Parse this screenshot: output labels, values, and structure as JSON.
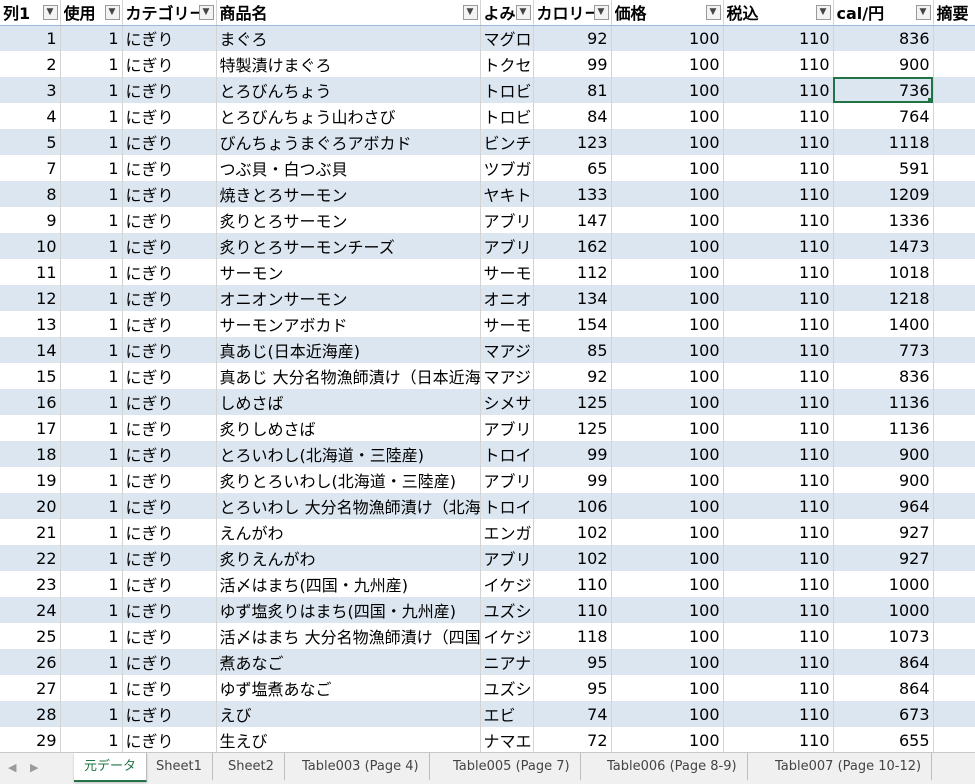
{
  "headers": [
    "列1",
    "使用",
    "カテゴリー",
    "商品名",
    "よみ",
    "カロリー",
    "価格",
    "税込",
    "cal/円",
    "摘要"
  ],
  "rows": [
    [
      "1",
      "1",
      "にぎり",
      "まぐろ",
      "マグロ",
      "92",
      "100",
      "110",
      "836",
      ""
    ],
    [
      "2",
      "1",
      "にぎり",
      "特製漬けまぐろ",
      "トクセ",
      "99",
      "100",
      "110",
      "900",
      ""
    ],
    [
      "3",
      "1",
      "にぎり",
      "とろびんちょう",
      "トロビ",
      "81",
      "100",
      "110",
      "736",
      ""
    ],
    [
      "4",
      "1",
      "にぎり",
      "とろびんちょう山わさび",
      "トロビ",
      "84",
      "100",
      "110",
      "764",
      ""
    ],
    [
      "5",
      "1",
      "にぎり",
      "びんちょうまぐろアボカド",
      "ビンチ",
      "123",
      "100",
      "110",
      "1118",
      ""
    ],
    [
      "7",
      "1",
      "にぎり",
      "つぶ貝・白つぶ貝",
      "ツブガ",
      "65",
      "100",
      "110",
      "591",
      ""
    ],
    [
      "8",
      "1",
      "にぎり",
      "焼きとろサーモン",
      "ヤキト",
      "133",
      "100",
      "110",
      "1209",
      ""
    ],
    [
      "9",
      "1",
      "にぎり",
      "炙りとろサーモン",
      "アブリ",
      "147",
      "100",
      "110",
      "1336",
      ""
    ],
    [
      "10",
      "1",
      "にぎり",
      "炙りとろサーモンチーズ",
      "アブリ",
      "162",
      "100",
      "110",
      "1473",
      ""
    ],
    [
      "11",
      "1",
      "にぎり",
      "サーモン",
      "サーモ",
      "112",
      "100",
      "110",
      "1018",
      ""
    ],
    [
      "12",
      "1",
      "にぎり",
      "オニオンサーモン",
      "オニオ",
      "134",
      "100",
      "110",
      "1218",
      ""
    ],
    [
      "13",
      "1",
      "にぎり",
      "サーモンアボカド",
      "サーモ",
      "154",
      "100",
      "110",
      "1400",
      ""
    ],
    [
      "14",
      "1",
      "にぎり",
      "真あじ(日本近海産)",
      "マアジ",
      "85",
      "100",
      "110",
      "773",
      ""
    ],
    [
      "15",
      "1",
      "にぎり",
      "真あじ 大分名物漁師漬け（日本近海",
      "マアジ",
      "92",
      "100",
      "110",
      "836",
      ""
    ],
    [
      "16",
      "1",
      "にぎり",
      "しめさば",
      "シメサ",
      "125",
      "100",
      "110",
      "1136",
      ""
    ],
    [
      "17",
      "1",
      "にぎり",
      "炙りしめさば",
      "アブリ",
      "125",
      "100",
      "110",
      "1136",
      ""
    ],
    [
      "18",
      "1",
      "にぎり",
      "とろいわし(北海道・三陸産)",
      "トロイ",
      "99",
      "100",
      "110",
      "900",
      ""
    ],
    [
      "19",
      "1",
      "にぎり",
      "炙りとろいわし(北海道・三陸産)",
      "アブリ",
      "99",
      "100",
      "110",
      "900",
      ""
    ],
    [
      "20",
      "1",
      "にぎり",
      "とろいわし 大分名物漁師漬け（北海",
      "トロイ",
      "106",
      "100",
      "110",
      "964",
      ""
    ],
    [
      "21",
      "1",
      "にぎり",
      "えんがわ",
      "エンガ",
      "102",
      "100",
      "110",
      "927",
      ""
    ],
    [
      "22",
      "1",
      "にぎり",
      "炙りえんがわ",
      "アブリ",
      "102",
      "100",
      "110",
      "927",
      ""
    ],
    [
      "23",
      "1",
      "にぎり",
      "活〆はまち(四国・九州産)",
      "イケジ",
      "110",
      "100",
      "110",
      "1000",
      ""
    ],
    [
      "24",
      "1",
      "にぎり",
      "ゆず塩炙りはまち(四国・九州産)",
      "ユズシ",
      "110",
      "100",
      "110",
      "1000",
      ""
    ],
    [
      "25",
      "1",
      "にぎり",
      "活〆はまち 大分名物漁師漬け（四国",
      "イケジ",
      "118",
      "100",
      "110",
      "1073",
      ""
    ],
    [
      "26",
      "1",
      "にぎり",
      "煮あなご",
      "ニアナ",
      "95",
      "100",
      "110",
      "864",
      ""
    ],
    [
      "27",
      "1",
      "にぎり",
      "ゆず塩煮あなご",
      "ユズシ",
      "95",
      "100",
      "110",
      "864",
      ""
    ],
    [
      "28",
      "1",
      "にぎり",
      "えび",
      "エビ",
      "74",
      "100",
      "110",
      "673",
      ""
    ],
    [
      "29",
      "1",
      "にぎり",
      "生えび",
      "ナマエ",
      "72",
      "100",
      "110",
      "655",
      ""
    ]
  ],
  "selected_cell": {
    "row": 3,
    "column": "cal/円",
    "value": "736"
  },
  "tabs": [
    "元データ",
    "Sheet1",
    "Sheet2",
    "Table003 (Page 4)",
    "Table005 (Page 7)",
    "Table006 (Page 8-9)",
    "Table007 (Page 10-12)"
  ],
  "active_tab": "元データ",
  "colors": {
    "band": "#dce6f1",
    "accent": "#217346"
  }
}
